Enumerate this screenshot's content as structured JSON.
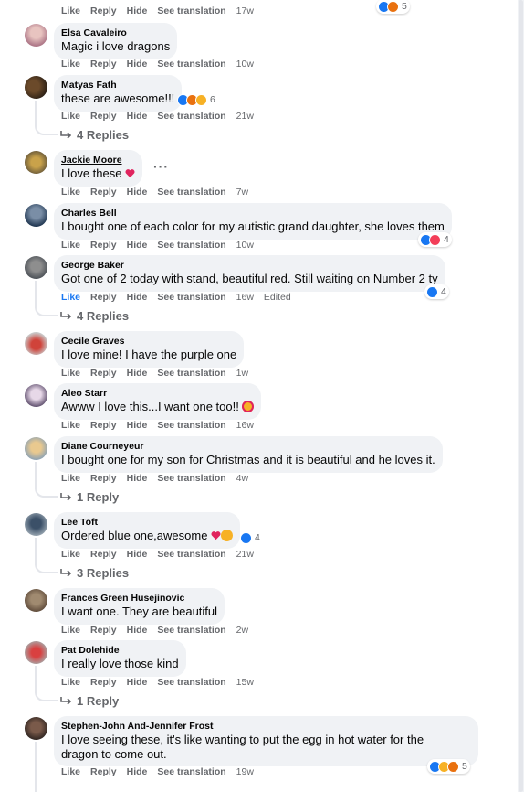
{
  "labels": {
    "like": "Like",
    "reply": "Reply",
    "hide": "Hide",
    "see_translation": "See translation",
    "edited": "Edited"
  },
  "top_partial": {
    "time": "17w",
    "reaction_count": "5"
  },
  "comments": [
    {
      "author": "Elsa Cavaleiro",
      "text": "Magic i love dragons",
      "time": "10w"
    },
    {
      "author": "Matyas Fath",
      "text": "these are awesome!!!",
      "time": "21w",
      "reaction_count": "6",
      "replies": "4 Replies"
    },
    {
      "author": "Jackie Moore",
      "text": "I love these",
      "time": "7w",
      "more": "···"
    },
    {
      "author": "Charles Bell",
      "text": "I bought one of each color for my autistic grand daughter, she loves them",
      "time": "10w",
      "reaction_count": "4"
    },
    {
      "author": "George Baker",
      "text": "Got one of 2 today with stand, beautiful red. Still waiting on Number 2 ty",
      "time": "16w",
      "reaction_count": "4",
      "replies": "4 Replies"
    },
    {
      "author": "Cecile Graves",
      "text": "I love mine! I have the purple one",
      "time": "1w"
    },
    {
      "author": "Aleo Starr",
      "text": "Awww I love this...I want one too!!",
      "time": "16w"
    },
    {
      "author": "Diane Courneyeur",
      "text": "I bought one for my son for Christmas and it is beautiful and he loves it.",
      "time": "4w",
      "replies": "1 Reply"
    },
    {
      "author": "Lee Toft",
      "text": "Ordered blue one,awesome",
      "time": "21w",
      "reaction_count": "4",
      "replies": "3 Replies"
    },
    {
      "author": "Frances Green Husejinovic",
      "text": "I want one. They are beautiful",
      "time": "2w"
    },
    {
      "author": "Pat Dolehide",
      "text": "I really love those kind",
      "time": "15w",
      "replies": "1 Reply"
    },
    {
      "author": "Stephen-John And-Jennifer Frost",
      "text_line1": "I love seeing these, it's like wanting to put the egg in hot water for the",
      "text_line2": "dragon to come out.",
      "time": "19w",
      "reaction_count": "5"
    }
  ],
  "colors": {
    "bubble": "#f0f2f5",
    "meta": "#65676b",
    "like_blue": "#1877f2",
    "love_red": "#f33e58"
  }
}
